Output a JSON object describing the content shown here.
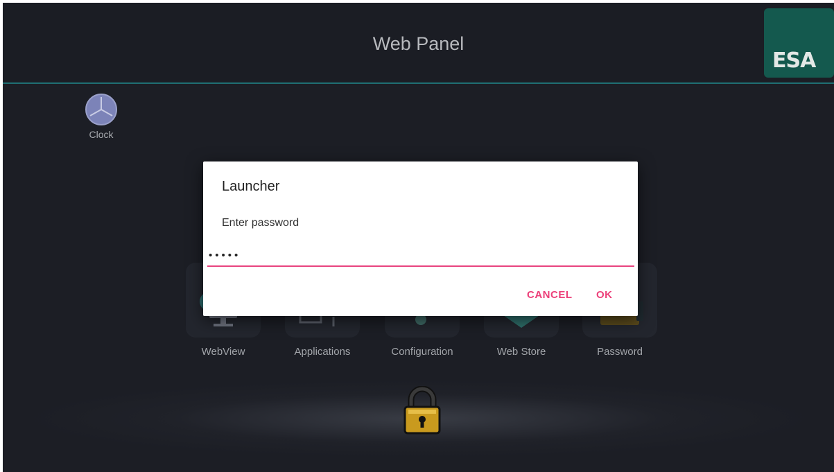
{
  "header": {
    "title": "Web Panel",
    "logo_text": "ESA",
    "accent_color": "#1f6f73",
    "logo_bg_color": "#14594e"
  },
  "widgets": {
    "clock_label": "Clock"
  },
  "apps": [
    {
      "label": "WebView",
      "icon": "webview-icon"
    },
    {
      "label": "Applications",
      "icon": "applications-icon"
    },
    {
      "label": "Configuration",
      "icon": "configuration-icon"
    },
    {
      "label": "Web Store",
      "icon": "web-store-icon"
    },
    {
      "label": "Password",
      "icon": "password-icon"
    }
  ],
  "lock": {
    "icon": "padlock-icon"
  },
  "dialog": {
    "title": "Launcher",
    "message": "Enter password",
    "password_value": "•••••",
    "cancel_label": "CANCEL",
    "ok_label": "OK",
    "accent_color": "#ec407a"
  }
}
